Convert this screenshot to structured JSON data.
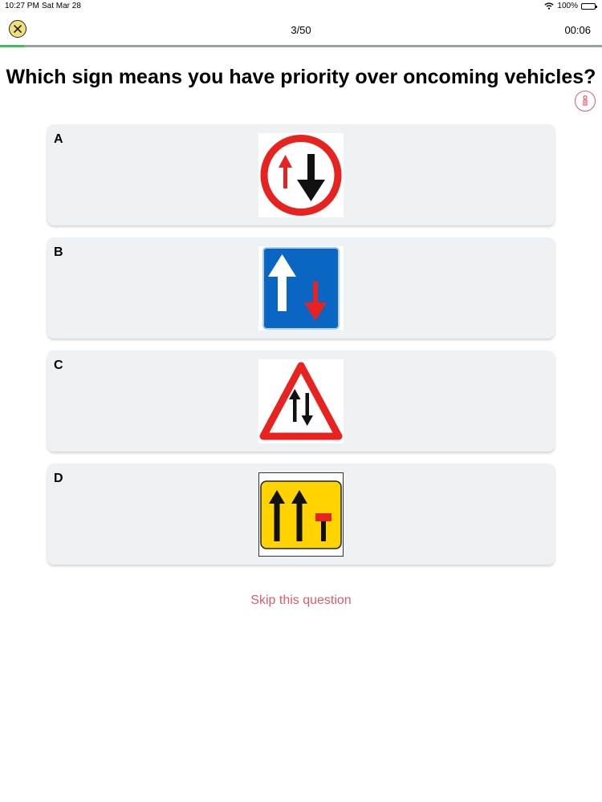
{
  "status": {
    "time": "10:27 PM",
    "date": "Sat Mar 28",
    "battery": "100%"
  },
  "header": {
    "counter": "3/50",
    "timer": "00:06",
    "progress": 0.04
  },
  "question": {
    "text": "Which sign means you have priority over oncoming vehicles?"
  },
  "answers": [
    {
      "letter": "A",
      "sign": "give-way-to-oncoming-sign"
    },
    {
      "letter": "B",
      "sign": "priority-over-oncoming-sign"
    },
    {
      "letter": "C",
      "sign": "two-way-traffic-warning-sign"
    },
    {
      "letter": "D",
      "sign": "lane-closure-sign"
    }
  ],
  "skip_label": "Skip this question",
  "colors": {
    "accent_green": "#3ebd5c",
    "skip_red": "#e05a6c",
    "sign_red": "#e8231f",
    "sign_blue": "#0a66c2",
    "sign_yellow": "#ffd200"
  }
}
